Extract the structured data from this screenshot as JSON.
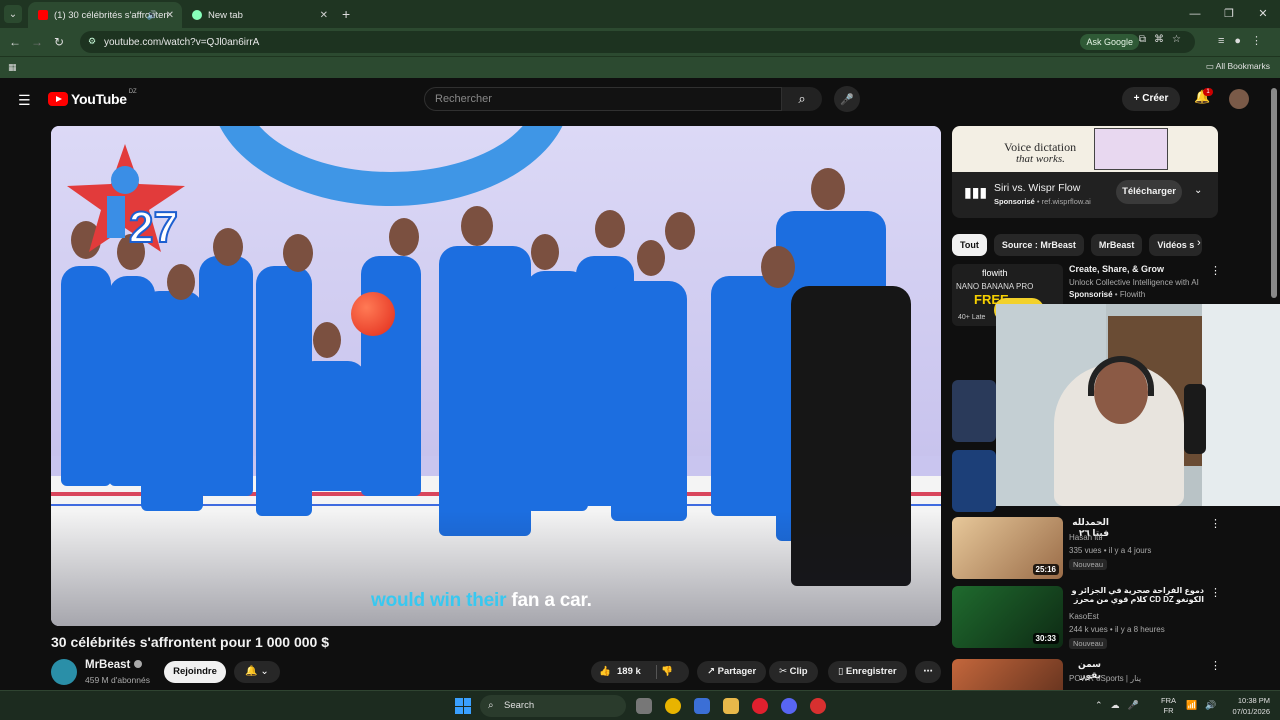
{
  "browser": {
    "tabs": [
      {
        "title": "(1) 30 célébrités s'affronten",
        "active": true
      },
      {
        "title": "New tab",
        "active": false
      }
    ],
    "url": "youtube.com/watch?v=QJl0an6irrA",
    "ask_google": "Ask Google",
    "all_bookmarks": "All Bookmarks"
  },
  "youtube": {
    "logo": "YouTube",
    "country": "DZ",
    "search_placeholder": "Rechercher",
    "create": "Créer",
    "notifications": "1"
  },
  "player": {
    "overlay_number": "27",
    "subtitle_plain_before": "would win ",
    "subtitle_highlight": "their",
    "subtitle_plain_after": " fan a car."
  },
  "video": {
    "title": "30 célébrités s'affrontent pour 1 000 000 $",
    "channel": "MrBeast",
    "subscribers": "459 M d'abonnés",
    "join": "Rejoindre",
    "likes": "189 k",
    "share": "Partager",
    "clip": "Clip",
    "save": "Enregistrer"
  },
  "ad": {
    "banner_line1": "Voice dictation",
    "banner_line2": "that works.",
    "title": "Siri vs. Wispr Flow",
    "sponsored": "Sponsorisé",
    "domain": "ref.wisprflow.ai",
    "cta": "Télécharger"
  },
  "chips": [
    "Tout",
    "Source : MrBeast",
    "MrBeast",
    "Vidéos s"
  ],
  "recommendations": [
    {
      "title": "Create, Share, & Grow",
      "line2": "Unlock Collective Intelligence with AI",
      "sponsored": "Sponsorisé",
      "advertiser": "Flowith",
      "thumb_line1": "flowith",
      "thumb_line2": "NANO BANANA PRO",
      "thumb_line3": "FREE",
      "thumb_line4": "40+ Late"
    },
    {
      "title": "الحمدلله فيتا ٢٦",
      "channel": "Hasan itti",
      "meta": "335 vues • il y a 4 jours",
      "badge": "Nouveau",
      "duration": "25:16"
    },
    {
      "title": "دموع الفراحة صحرية في الجزائر و الكونغو CD DZ كلام قوي من محرز",
      "channel": "KasoEst",
      "meta": "244 k vues • il y a 8 heures",
      "badge": "Nouveau",
      "duration": "30:33"
    },
    {
      "title": "سمن بقور",
      "channel": "POWR eSports | ينار"
    }
  ],
  "taskbar": {
    "search": "Search",
    "lang_top": "FRA",
    "lang_bottom": "FR",
    "time": "10:38 PM",
    "date": "07/01/2026"
  }
}
